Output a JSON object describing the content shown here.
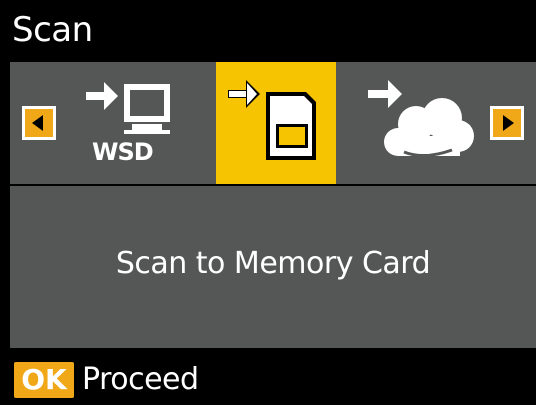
{
  "title": "Scan",
  "options": [
    {
      "icon": "scan-to-wsd-icon",
      "badge": "WSD",
      "selected": false
    },
    {
      "icon": "scan-to-memory-card-icon",
      "selected": true
    },
    {
      "icon": "scan-to-cloud-icon",
      "selected": false
    }
  ],
  "selected_label": "Scan to Memory Card",
  "footer": {
    "ok_key": "OK",
    "action": "Proceed"
  },
  "colors": {
    "accent": "#f0a818",
    "selected": "#f6c400",
    "panel": "#555656"
  }
}
